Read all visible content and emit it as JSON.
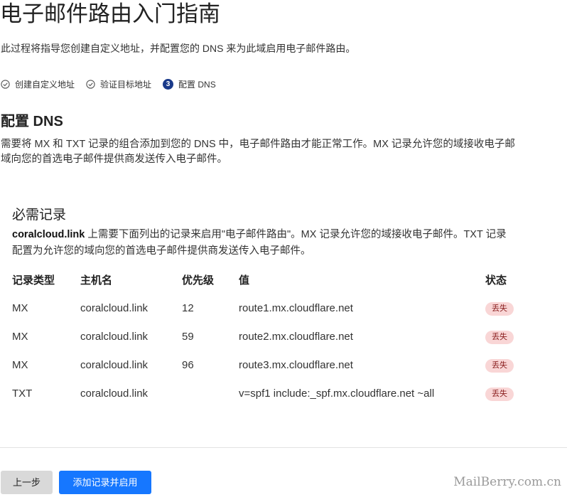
{
  "page_title": "电子邮件路由入门指南",
  "intro": "此过程将指导您创建自定义地址，并配置您的 DNS 来为此域启用电子邮件路由。",
  "steps": [
    {
      "label": "创建自定义地址",
      "state": "done"
    },
    {
      "label": "验证目标地址",
      "state": "done"
    },
    {
      "label": "配置 DNS",
      "state": "current",
      "number": "3"
    }
  ],
  "section": {
    "title": "配置 DNS",
    "desc_line1": "需要将 MX 和 TXT 记录的组合添加到您的 DNS 中，电子邮件路由才能正常工作。MX 记录允许您的域接收电子邮",
    "desc_line2": "域向您的首选电子邮件提供商发送传入电子邮件。"
  },
  "required": {
    "title": "必需记录",
    "domain": "coralcloud.link",
    "desc_line1_rest": " 上需要下面列出的记录来启用\"电子邮件路由\"。MX 记录允许您的域接收电子邮件。TXT 记录",
    "desc_line2": "配置为允许您的域向您的首选电子邮件提供商发送传入电子邮件。"
  },
  "table": {
    "headers": {
      "type": "记录类型",
      "host": "主机名",
      "priority": "优先级",
      "value": "值",
      "status": "状态"
    },
    "rows": [
      {
        "type": "MX",
        "host": "coralcloud.link",
        "priority": "12",
        "value": "route1.mx.cloudflare.net",
        "status": "丢失"
      },
      {
        "type": "MX",
        "host": "coralcloud.link",
        "priority": "59",
        "value": "route2.mx.cloudflare.net",
        "status": "丢失"
      },
      {
        "type": "MX",
        "host": "coralcloud.link",
        "priority": "96",
        "value": "route3.mx.cloudflare.net",
        "status": "丢失"
      },
      {
        "type": "TXT",
        "host": "coralcloud.link",
        "priority": "",
        "value": "v=spf1 include:_spf.mx.cloudflare.net ~all",
        "status": "丢失"
      }
    ]
  },
  "buttons": {
    "back": "上一步",
    "enable": "添加记录并启用"
  },
  "watermark": "MailBerry.com.cn",
  "colors": {
    "primary_button": "#1677ff",
    "secondary_button": "#d9d9d9",
    "status_missing_bg": "#f9d6d6",
    "step_current": "#1a3a8a"
  }
}
